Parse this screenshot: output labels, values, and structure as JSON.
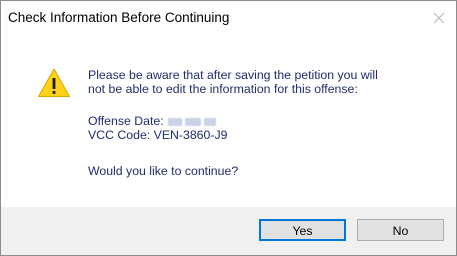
{
  "window": {
    "title": "Check Information Before Continuing"
  },
  "icons": {
    "warning": "warning-icon",
    "close": "close-icon"
  },
  "message": {
    "line1": "Please be aware that after saving the petition you will",
    "line2": "not be able to edit the information for this offense:"
  },
  "fields": {
    "offense_date_label": "Offense Date:",
    "vcc_code_label": "VCC Code:",
    "vcc_code_value": "VEN-3860-J9"
  },
  "question": "Would you like to continue?",
  "buttons": {
    "yes": "Yes",
    "no": "No"
  },
  "colors": {
    "accent": "#0078d7",
    "warning_fill": "#fcd116",
    "text": "#1f2d6b"
  }
}
